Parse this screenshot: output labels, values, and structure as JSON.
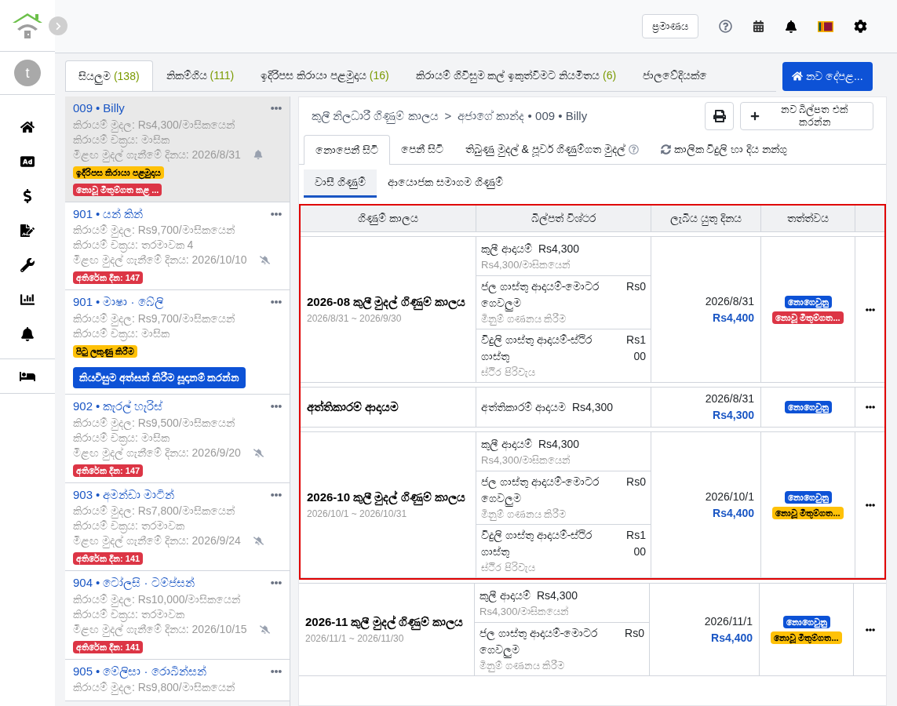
{
  "sidebar": {
    "avatar": "t"
  },
  "header": {
    "button": "ප්‍රමාණය"
  },
  "tabs": [
    {
      "label": "සියලුම",
      "count": "(138)",
      "selected": true
    },
    {
      "label": "නිකම්ගිය",
      "count": "(111)",
      "selected": false
    },
    {
      "label": "ඉදිරිපස කිරායා පළමුදාය",
      "count": "(16)",
      "selected": false
    },
    {
      "label": "කිරායම් ගිවිසුම කල් ඉකුත්වීමට නියමිතය",
      "count": "(6)",
      "selected": false
    },
    {
      "label": "ජාලවේදියක් ෙ",
      "selected": false
    }
  ],
  "new_property_button": "නව දේපළ...",
  "tenants": [
    {
      "number": "009",
      "sep": "•",
      "name": "Billy",
      "rent": "කිරායම් මුදල: Rs4,300/මාසිකයෙන්",
      "cycle": "කිරායම් චක්‍රය: මාසික",
      "due_label": "මීළඟ මුදල් ගැනීමේ දිනය:",
      "due": "2026/8/31",
      "reminder": true,
      "badges": [
        {
          "text": "ඉදිරිපස කිරායා පළමුදාය",
          "color": "#ffc107"
        },
        {
          "text": "නොවූ මිතුම්ගත කළ ...",
          "color": "#dc3545"
        }
      ],
      "selected": true
    },
    {
      "number": "901",
      "sep": "•",
      "name": "යන් කින්",
      "rent": "කිරායම් මුදල: Rs9,700/මාසිකයෙන්",
      "cycle": "කිරායම් චක්‍රය: තරමාවක 4",
      "due_label": "මීළඟ මුදල් ගැනීමේ දිනය:",
      "due": "2026/10/10",
      "reminder": false,
      "badges": [
        {
          "text": "අතිරේක දින: 147",
          "color": "#dc3545"
        }
      ],
      "selected": false
    },
    {
      "number": "901",
      "sep": "•",
      "name": "මාෂා · බේලි",
      "rent": "කිරායම් මුදල: Rs9,700/මාසිකයෙන්",
      "cycle": "කිරායම් චක්‍රය: මාසික",
      "badges": [
        {
          "text": "පිටු ලකුණු කිරීම",
          "color": "#ffc107"
        }
      ],
      "action": "කියවිසුම අත්සන් කිරීම සූදානම් කරන්න",
      "selected": false
    },
    {
      "number": "902",
      "sep": "•",
      "name": "කැරල් හැරිස්",
      "rent": "කිරායම් මුදල: Rs9,500/මාසිකයෙන්",
      "cycle": "කිරායම් චක්‍රය: මාසික",
      "due_label": "මීළඟ මුදල් ගැනීමේ දිනය:",
      "due": "2026/9/20",
      "reminder": false,
      "badges": [
        {
          "text": "අතිරේක දින: 147",
          "color": "#dc3545"
        }
      ],
      "selected": false
    },
    {
      "number": "903",
      "sep": "•",
      "name": "අමන්ඩා මාටින්",
      "rent": "කිරායම් මුදල: Rs7,800/මාසිකයෙන්",
      "cycle": "කිරායම් චක්‍රය: තරමාවක",
      "due_label": "මීළඟ මුදල් ගැනීමේ දිනය:",
      "due": "2026/9/24",
      "reminder": false,
      "badges": [
        {
          "text": "අතිරේක දින: 141",
          "color": "#dc3545"
        }
      ],
      "selected": false
    },
    {
      "number": "904",
      "sep": "•",
      "name": "ටෝලසි · ටම්ප්සන්",
      "rent": "කිරායම් මුදල: Rs10,000/මාසිකයෙන්",
      "cycle": "කිරායම් චක්‍රය: තරමාවක",
      "due_label": "මීළඟ මුදල් ගැනීමේ දිනය:",
      "due": "2026/10/15",
      "reminder": false,
      "badges": [
        {
          "text": "අතිරේක දින: 141",
          "color": "#dc3545"
        }
      ],
      "selected": false
    },
    {
      "number": "905",
      "sep": "•",
      "name": "මේලිසා · රොබින්සන්",
      "rent": "කිරායම් මුදල: Rs9,800/මාසිකයෙන්",
      "selected": false
    }
  ],
  "detail": {
    "breadcrumb": [
      "කුලී නිලධාරී ගිණුම් කාලය",
      "අජාගේ කාන්ද • 009 • Billy"
    ],
    "separator": ">",
    "add_bill_button": "නව බිල්පත එක් කරන්න",
    "tabs": [
      {
        "label": "නොපෙනී සිටි",
        "kind": "plain",
        "selected": true
      },
      {
        "label": "පෙනී සිටි",
        "kind": "plain",
        "selected": false
      },
      {
        "label": "තිබුණු මුදල් & පූර්ව ගිණුම්ගත මුදල්",
        "kind": "help",
        "selected": false
      },
      {
        "label": "කාලික විදුලි හා දිය නන්ගු",
        "kind": "refresh",
        "selected": false
      }
    ],
    "subtabs": [
      {
        "label": "වාසී ගිණුම්",
        "selected": true
      },
      {
        "label": "ආයොජක සමාගම ගිණුම්",
        "selected": false
      }
    ]
  },
  "table": {
    "columns": [
      "ගිණුම් කාලය",
      "බිල්පත් විශ්ථර",
      "ලැබිය යුතු දිනය",
      "තත්ත්වය"
    ],
    "rows": [
      {
        "title": "2026-08 කුලී මුදල් ගිණුම් කාලය",
        "range": "2026/8/31 ~ 2026/9/30",
        "selected": true,
        "items": [
          {
            "kind": "inline",
            "label": "කුලී ආදායම්",
            "amount": "Rs4,300",
            "sub": "Rs4,300/මාසිකයෙන්"
          },
          {
            "kind": "split",
            "label": "ජල ගාස්තු ආදායම්-මොටර ගෙවලුම",
            "amount": "Rs0",
            "sub": "මිනුම් ගණනය කිරීම"
          },
          {
            "kind": "split",
            "label": "විදුලි ගාස්තු ආදායම්-ස්ථිර ගාස්තු",
            "amount": "Rs100",
            "sub": "ස්ථිර පිරිවැය"
          }
        ],
        "date": "2026/8/31",
        "total": "Rs4,400",
        "statuses": [
          {
            "text": "නොගෙවුනු",
            "color": "#0d52d6"
          },
          {
            "text": "නොවූ මිතුම්ගත...",
            "color": "#dc3545"
          }
        ]
      },
      {
        "title": "අත්තිකාරම් ආදායම",
        "selected": true,
        "items": [
          {
            "kind": "inline",
            "label": "අත්තිකාරම් ආදායම",
            "amount": "Rs4,300"
          }
        ],
        "date": "2026/8/31",
        "total": "Rs4,300",
        "statuses": [
          {
            "text": "නොගෙවුනු",
            "color": "#0d52d6"
          }
        ]
      },
      {
        "title": "2026-10 කුලී මුදල් ගිණුම් කාලය",
        "range": "2026/10/1 ~ 2026/10/31",
        "selected": true,
        "items": [
          {
            "kind": "inline",
            "label": "කුලී ආදායම්",
            "amount": "Rs4,300",
            "sub": "Rs4,300/මාසිකයෙන්"
          },
          {
            "kind": "split",
            "label": "ජල ගාස්තු ආදායම්-මොටර ගෙවලුම",
            "amount": "Rs0",
            "sub": "මිනුම් ගණනය කිරීම"
          },
          {
            "kind": "split",
            "label": "විදුලි ගාස්තු ආදායම්-ස්ථිර ගාස්තු",
            "amount": "Rs100",
            "sub": "ස්ථිර පිරිවැය"
          }
        ],
        "date": "2026/10/1",
        "total": "Rs4,400",
        "statuses": [
          {
            "text": "නොගෙවුනු",
            "color": "#0d52d6"
          },
          {
            "text": "නොවූ මිතුම්ගත...",
            "color": "#ffc107"
          }
        ]
      },
      {
        "title": "2026-11 කුලී මුදල් ගිණුම් කාලය",
        "range": "2026/11/1 ~ 2026/11/30",
        "selected": false,
        "items": [
          {
            "kind": "inline",
            "label": "කුලී ආදායම්",
            "amount": "Rs4,300",
            "sub": "Rs4,300/මාසිකයෙන්"
          },
          {
            "kind": "split",
            "label": "ජල ගාස්තු ආදායම්-මොටර ගෙවලුම",
            "amount": "Rs0",
            "sub": "මිනුම් ගණනය කිරීම"
          }
        ],
        "date": "2026/11/1",
        "total": "Rs4,400",
        "statuses": [
          {
            "text": "නොගෙවුනු",
            "color": "#0d52d6"
          },
          {
            "text": "නොවූ මිතුම්ගත...",
            "color": "#ffc107"
          }
        ]
      }
    ]
  }
}
